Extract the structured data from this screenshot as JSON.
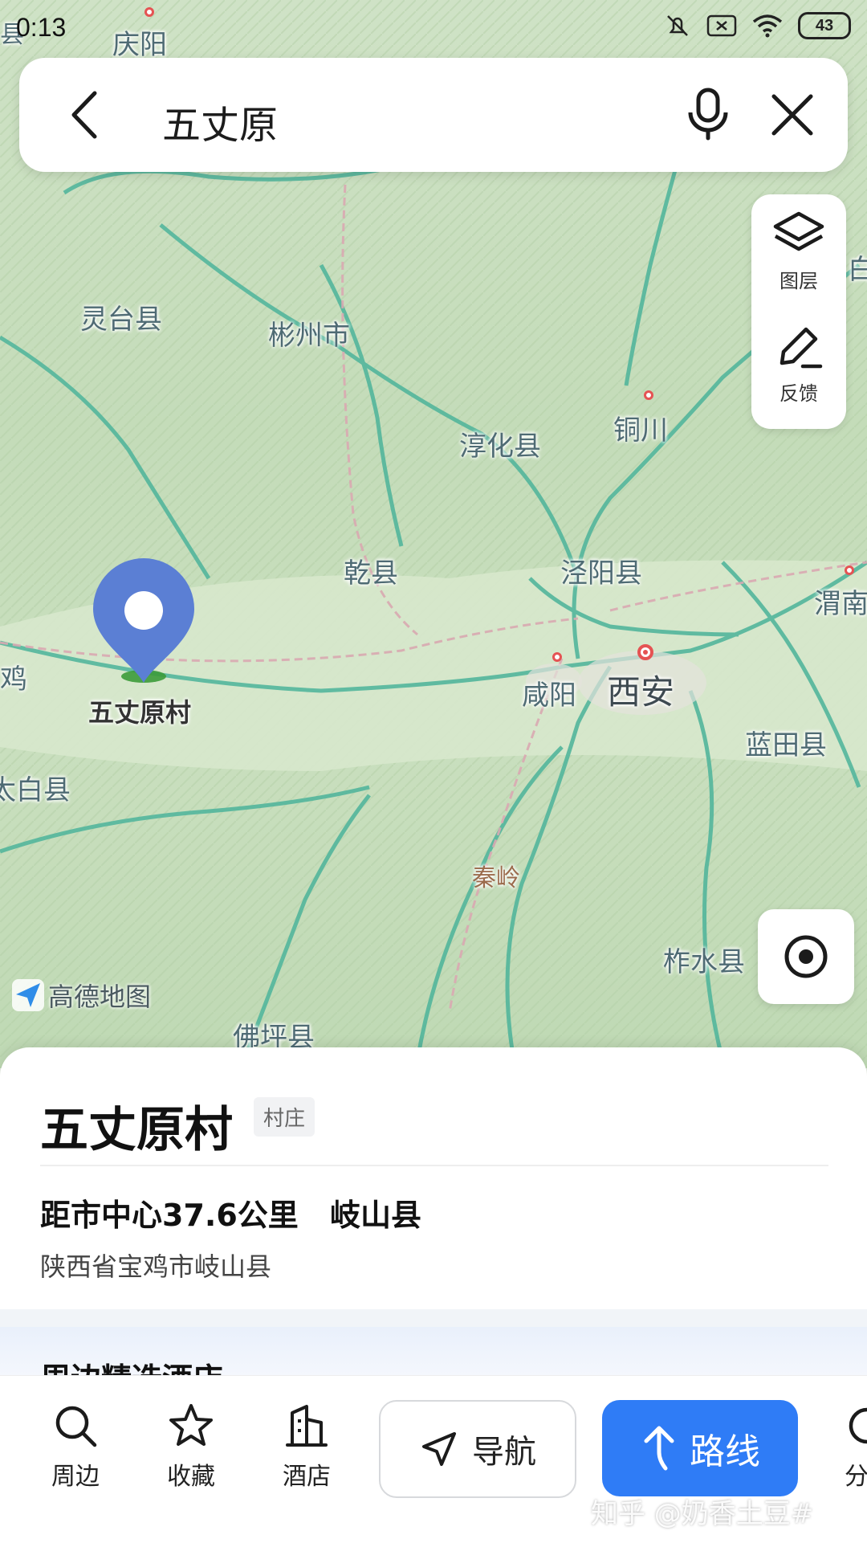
{
  "status_bar": {
    "time": "0:13",
    "battery": "43"
  },
  "search": {
    "query": "五丈原"
  },
  "tools": {
    "layers_label": "图层",
    "feedback_label": "反馈"
  },
  "map": {
    "labels": {
      "qingyang": "庆阳",
      "lingtai": "灵台县",
      "binzhou": "彬州市",
      "chunhua": "淳化县",
      "tongchuan": "铜川",
      "qianxian": "乾县",
      "jingyang": "泾阳县",
      "weinan": "渭南",
      "xianyang": "咸阳",
      "xian": "西安",
      "lantian": "蓝田县",
      "baoji_partial": "鸡",
      "taibai_partial": "太白县",
      "qinling": "秦岭",
      "zhashui": "柞水县",
      "foping": "佛坪县",
      "edge_left_top": "县",
      "edge_right_top": "白"
    },
    "pin_label": "五丈原村",
    "brand": "高德地图"
  },
  "place": {
    "name": "五丈原村",
    "tag": "村庄",
    "distance": "距市中心37.6公里",
    "county": "岐山县",
    "address": "陕西省宝鸡市岐山县",
    "nearby_title": "周边精选酒店"
  },
  "actions": {
    "nearby": "周边",
    "favorite": "收藏",
    "hotel": "酒店",
    "navigate": "导航",
    "route": "路线",
    "share_partial": "分"
  },
  "credit": "知乎 @奶香土豆#",
  "colors": {
    "route_blue": "#2f7cf6",
    "pin_blue": "#5b7fd4",
    "city_red": "#e55353",
    "road_green": "#4fb59a"
  }
}
